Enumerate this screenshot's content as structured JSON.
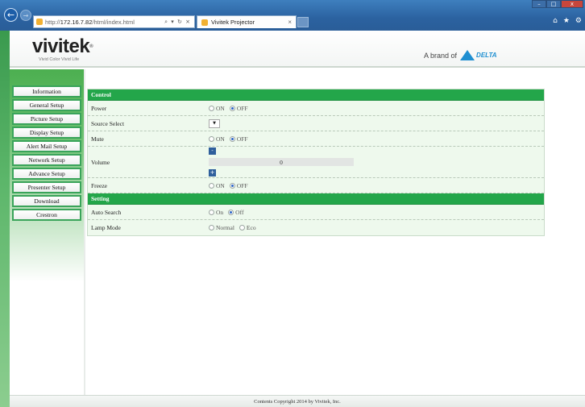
{
  "browser": {
    "address": {
      "prefix": "http://",
      "host": "172.16.7.82",
      "path": "/html/index.html",
      "tools": "⌕ ▾ ↻ ×"
    },
    "tab_title": "Vivitek Projector",
    "tab_close": "×",
    "win_min": "–",
    "win_max": "□",
    "win_close": "x",
    "home_icon": "⌂",
    "star_icon": "★",
    "gear_icon": "⚙",
    "back_icon": "←",
    "forward_icon": "→"
  },
  "header": {
    "logo": "vivitek",
    "logo_reg": "®",
    "tagline": "Vivid Color Vivid Life",
    "brand_prefix": "A brand of",
    "brand_name": "DELTA"
  },
  "sidebar": {
    "items": [
      {
        "label": "Information"
      },
      {
        "label": "General Setup"
      },
      {
        "label": "Picture Setup"
      },
      {
        "label": "Display Setup"
      },
      {
        "label": "Alert Mail Setup"
      },
      {
        "label": "Network Setup"
      },
      {
        "label": "Advance Setup"
      },
      {
        "label": "Presenter Setup"
      },
      {
        "label": "Download"
      },
      {
        "label": "Crestron"
      }
    ]
  },
  "control": {
    "title": "Control",
    "power": {
      "label": "Power",
      "on": "ON",
      "off": "OFF",
      "selected": "OFF"
    },
    "source_select": {
      "label": "Source Select",
      "value": "",
      "arrow": "▼"
    },
    "mute": {
      "label": "Mute",
      "on": "ON",
      "off": "OFF",
      "selected": "OFF"
    },
    "volume": {
      "label": "Volume",
      "value": "0",
      "minus": "-",
      "plus": "+"
    },
    "freeze": {
      "label": "Freeze",
      "on": "ON",
      "off": "OFF",
      "selected": "OFF"
    }
  },
  "setting": {
    "title": "Setting",
    "auto_search": {
      "label": "Auto Search",
      "on": "On",
      "off": "Off",
      "selected": "Off"
    },
    "lamp_mode": {
      "label": "Lamp Mode",
      "normal": "Normal",
      "eco": "Eco",
      "selected": ""
    }
  },
  "footer": {
    "text": "Contents Copyright 2014 by Vivitek, Inc."
  },
  "colors": {
    "accent_green": "#23a64a",
    "panel_bg": "#eef9ed",
    "chrome_blue": "#2b62a0"
  }
}
